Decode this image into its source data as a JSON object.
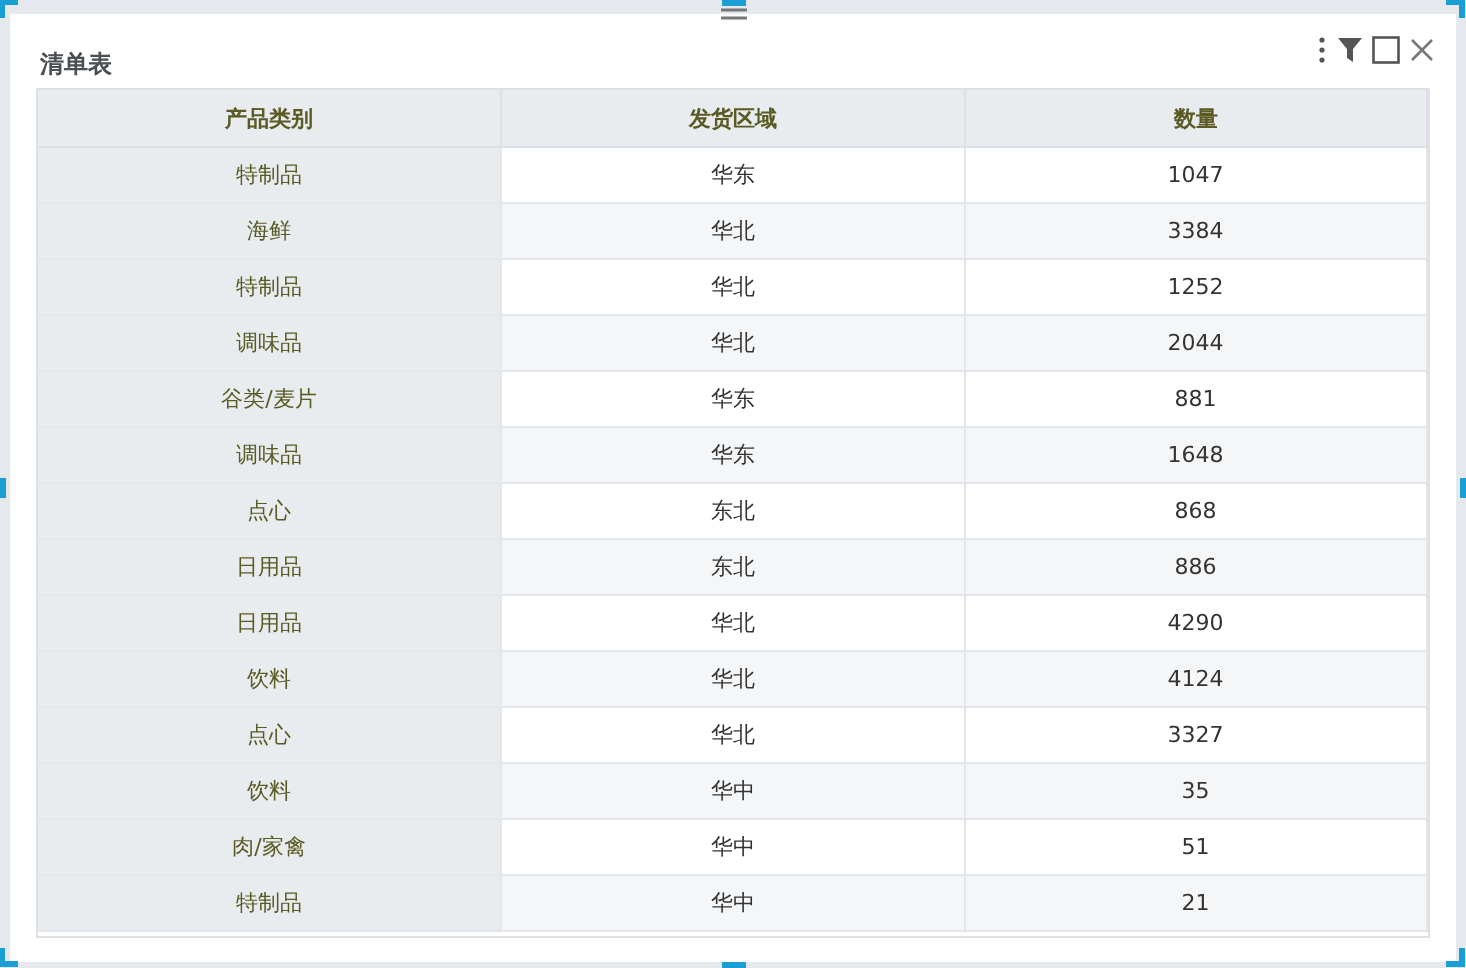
{
  "panel": {
    "title": "清单表"
  },
  "table": {
    "columns": [
      "产品类别",
      "发货区域",
      "数量"
    ],
    "rows": [
      [
        "特制品",
        "华东",
        "1047"
      ],
      [
        "海鲜",
        "华北",
        "3384"
      ],
      [
        "特制品",
        "华北",
        "1252"
      ],
      [
        "调味品",
        "华北",
        "2044"
      ],
      [
        "谷类/麦片",
        "华东",
        "881"
      ],
      [
        "调味品",
        "华东",
        "1648"
      ],
      [
        "点心",
        "东北",
        "868"
      ],
      [
        "日用品",
        "东北",
        "886"
      ],
      [
        "日用品",
        "华北",
        "4290"
      ],
      [
        "饮料",
        "华北",
        "4124"
      ],
      [
        "点心",
        "华北",
        "3327"
      ],
      [
        "饮料",
        "华中",
        "35"
      ],
      [
        "肉/家禽",
        "华中",
        "51"
      ],
      [
        "特制品",
        "华中",
        "21"
      ]
    ]
  }
}
